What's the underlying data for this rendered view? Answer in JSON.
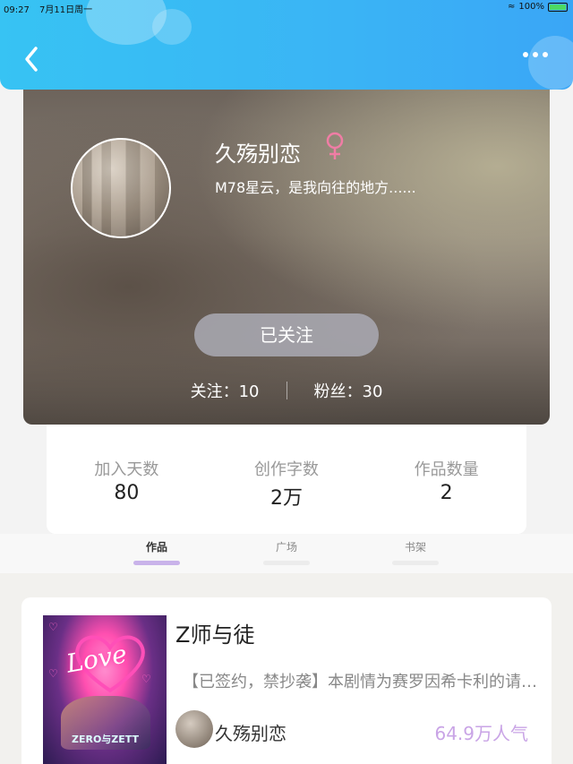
{
  "status_bar": {
    "time": "09:27",
    "date": "7月11日周一",
    "battery": "100%"
  },
  "nav": {
    "back_icon": "chevron-left-icon",
    "more_icon": "more-dots-icon"
  },
  "profile": {
    "name": "久殇别恋",
    "gender_icon": "female-icon",
    "bio": "M78星云，是我向往的地方......",
    "follow_button": "已关注",
    "following": "关注：10",
    "followers": "粉丝：30"
  },
  "stats": [
    {
      "label": "加入天数",
      "value": "80"
    },
    {
      "label": "创作字数",
      "value": "2万"
    },
    {
      "label": "作品数量",
      "value": "2"
    }
  ],
  "tabs": [
    {
      "label": "作品",
      "active": true
    },
    {
      "label": "广场",
      "active": false
    },
    {
      "label": "书架",
      "active": false
    }
  ],
  "works": [
    {
      "title": "Z师与徒",
      "description": "【已签约，禁抄袭】本剧情为赛罗因希卡利的请求……",
      "author": "久殇别恋",
      "popularity": "64.9万人气",
      "cover_text": "Love",
      "cover_caption": "ZERO与ZETT"
    }
  ],
  "colors": {
    "header_blue": "#3ab4f5",
    "tab_active_indicator": "#c9b3ea",
    "popularity_purple": "#c9a4e6",
    "gender_pink": "#f07da5"
  }
}
